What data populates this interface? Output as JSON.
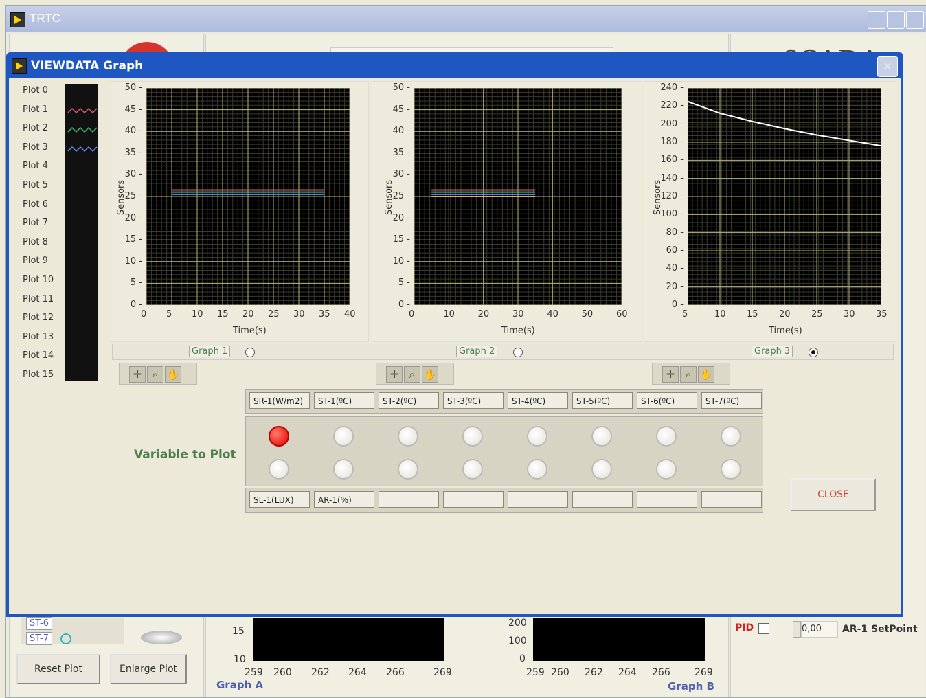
{
  "parent_window": {
    "title": "TRTC",
    "logo_text": "SCADA",
    "bottom": {
      "channels": [
        "ST-6",
        "ST-7"
      ],
      "reset_plot_label": "Reset Plot",
      "enlarge_plot_label": "Enlarge Plot",
      "graph_a": {
        "name": "Graph A",
        "y_ticks": [
          "15",
          "10"
        ],
        "x_ticks": [
          "259",
          "260",
          "262",
          "264",
          "266",
          "269"
        ]
      },
      "graph_b": {
        "name": "Graph B",
        "y_ticks": [
          "200",
          "100",
          "0"
        ],
        "x_ticks": [
          "259",
          "260",
          "262",
          "264",
          "266",
          "269"
        ]
      },
      "pid_label": "PID",
      "setpoint_value": "0,00",
      "setpoint_label": "AR-1 SetPoint"
    }
  },
  "dialog": {
    "title": "VIEWDATA Graph",
    "legend": [
      "Plot 0",
      "Plot 1",
      "Plot 2",
      "Plot 3",
      "Plot 4",
      "Plot 5",
      "Plot 6",
      "Plot 7",
      "Plot 8",
      "Plot 9",
      "Plot 10",
      "Plot 11",
      "Plot 12",
      "Plot 13",
      "Plot 14",
      "Plot 15"
    ],
    "legend_colors": {
      "plot1": "#e05a7a",
      "plot2": "#3fbf6e",
      "plot3": "#6f8cff"
    },
    "graphs": [
      {
        "name": "Graph 1",
        "selected": false,
        "ylabel": "Sensors",
        "xlabel": "Time(s)",
        "y_ticks": [
          "50",
          "45",
          "40",
          "35",
          "30",
          "25",
          "20",
          "15",
          "10",
          "5",
          "0"
        ],
        "x_ticks": [
          "0",
          "5",
          "10",
          "15",
          "20",
          "25",
          "30",
          "35",
          "40"
        ]
      },
      {
        "name": "Graph 2",
        "selected": false,
        "ylabel": "Sensors",
        "xlabel": "Time(s)",
        "y_ticks": [
          "50",
          "45",
          "40",
          "35",
          "30",
          "25",
          "20",
          "15",
          "10",
          "5",
          "0"
        ],
        "x_ticks": [
          "0",
          "10",
          "20",
          "30",
          "40",
          "50",
          "60"
        ]
      },
      {
        "name": "Graph 3",
        "selected": true,
        "ylabel": "Sensors",
        "xlabel": "Time(s)",
        "y_ticks": [
          "240",
          "220",
          "200",
          "180",
          "160",
          "140",
          "120",
          "100",
          "80",
          "60",
          "40",
          "20",
          "0"
        ],
        "x_ticks": [
          "5",
          "10",
          "15",
          "20",
          "25",
          "30",
          "35"
        ]
      }
    ],
    "variable_title": "Variable to Plot",
    "top_variables": [
      "SR-1(W/m2)",
      "ST-1(ºC)",
      "ST-2(ºC)",
      "ST-3(ºC)",
      "ST-4(ºC)",
      "ST-5(ºC)",
      "ST-6(ºC)",
      "ST-7(ºC)"
    ],
    "bottom_variables": [
      "SL-1(LUX)",
      "AR-1(%)",
      "",
      "",
      "",
      "",
      "",
      ""
    ],
    "selected_variable": "SR-1(W/m2)",
    "close_label": "CLOSE",
    "colors": {
      "title_bar": "#1e56c2",
      "grid": "#b8b27a",
      "led_on": "#e60000"
    }
  },
  "chart_data": [
    {
      "type": "line",
      "title": "Graph 1",
      "xlabel": "Time(s)",
      "ylabel": "Sensors",
      "xlim": [
        0,
        40
      ],
      "ylim": [
        0,
        50
      ],
      "grid": true,
      "series": [
        {
          "x": [
            5,
            35
          ],
          "y": [
            26.5,
            26.5
          ]
        },
        {
          "x": [
            5,
            35
          ],
          "y": [
            26,
            26
          ]
        },
        {
          "x": [
            5,
            35
          ],
          "y": [
            25.5,
            25.5
          ]
        }
      ]
    },
    {
      "type": "line",
      "title": "Graph 2",
      "xlabel": "Time(s)",
      "ylabel": "Sensors",
      "xlim": [
        0,
        60
      ],
      "ylim": [
        0,
        50
      ],
      "grid": true,
      "series": [
        {
          "x": [
            5,
            35
          ],
          "y": [
            26.5,
            26.5
          ]
        },
        {
          "x": [
            5,
            35
          ],
          "y": [
            26,
            26
          ]
        },
        {
          "x": [
            5,
            35
          ],
          "y": [
            25.5,
            25.5
          ]
        },
        {
          "x": [
            5,
            35
          ],
          "y": [
            25,
            25
          ]
        }
      ]
    },
    {
      "type": "line",
      "title": "Graph 3",
      "xlabel": "Time(s)",
      "ylabel": "Sensors",
      "xlim": [
        5,
        35
      ],
      "ylim": [
        0,
        240
      ],
      "grid": true,
      "series": [
        {
          "x": [
            5,
            10,
            15,
            20,
            25,
            30,
            35
          ],
          "y": [
            225,
            212,
            203,
            195,
            188,
            182,
            176
          ]
        }
      ]
    }
  ]
}
